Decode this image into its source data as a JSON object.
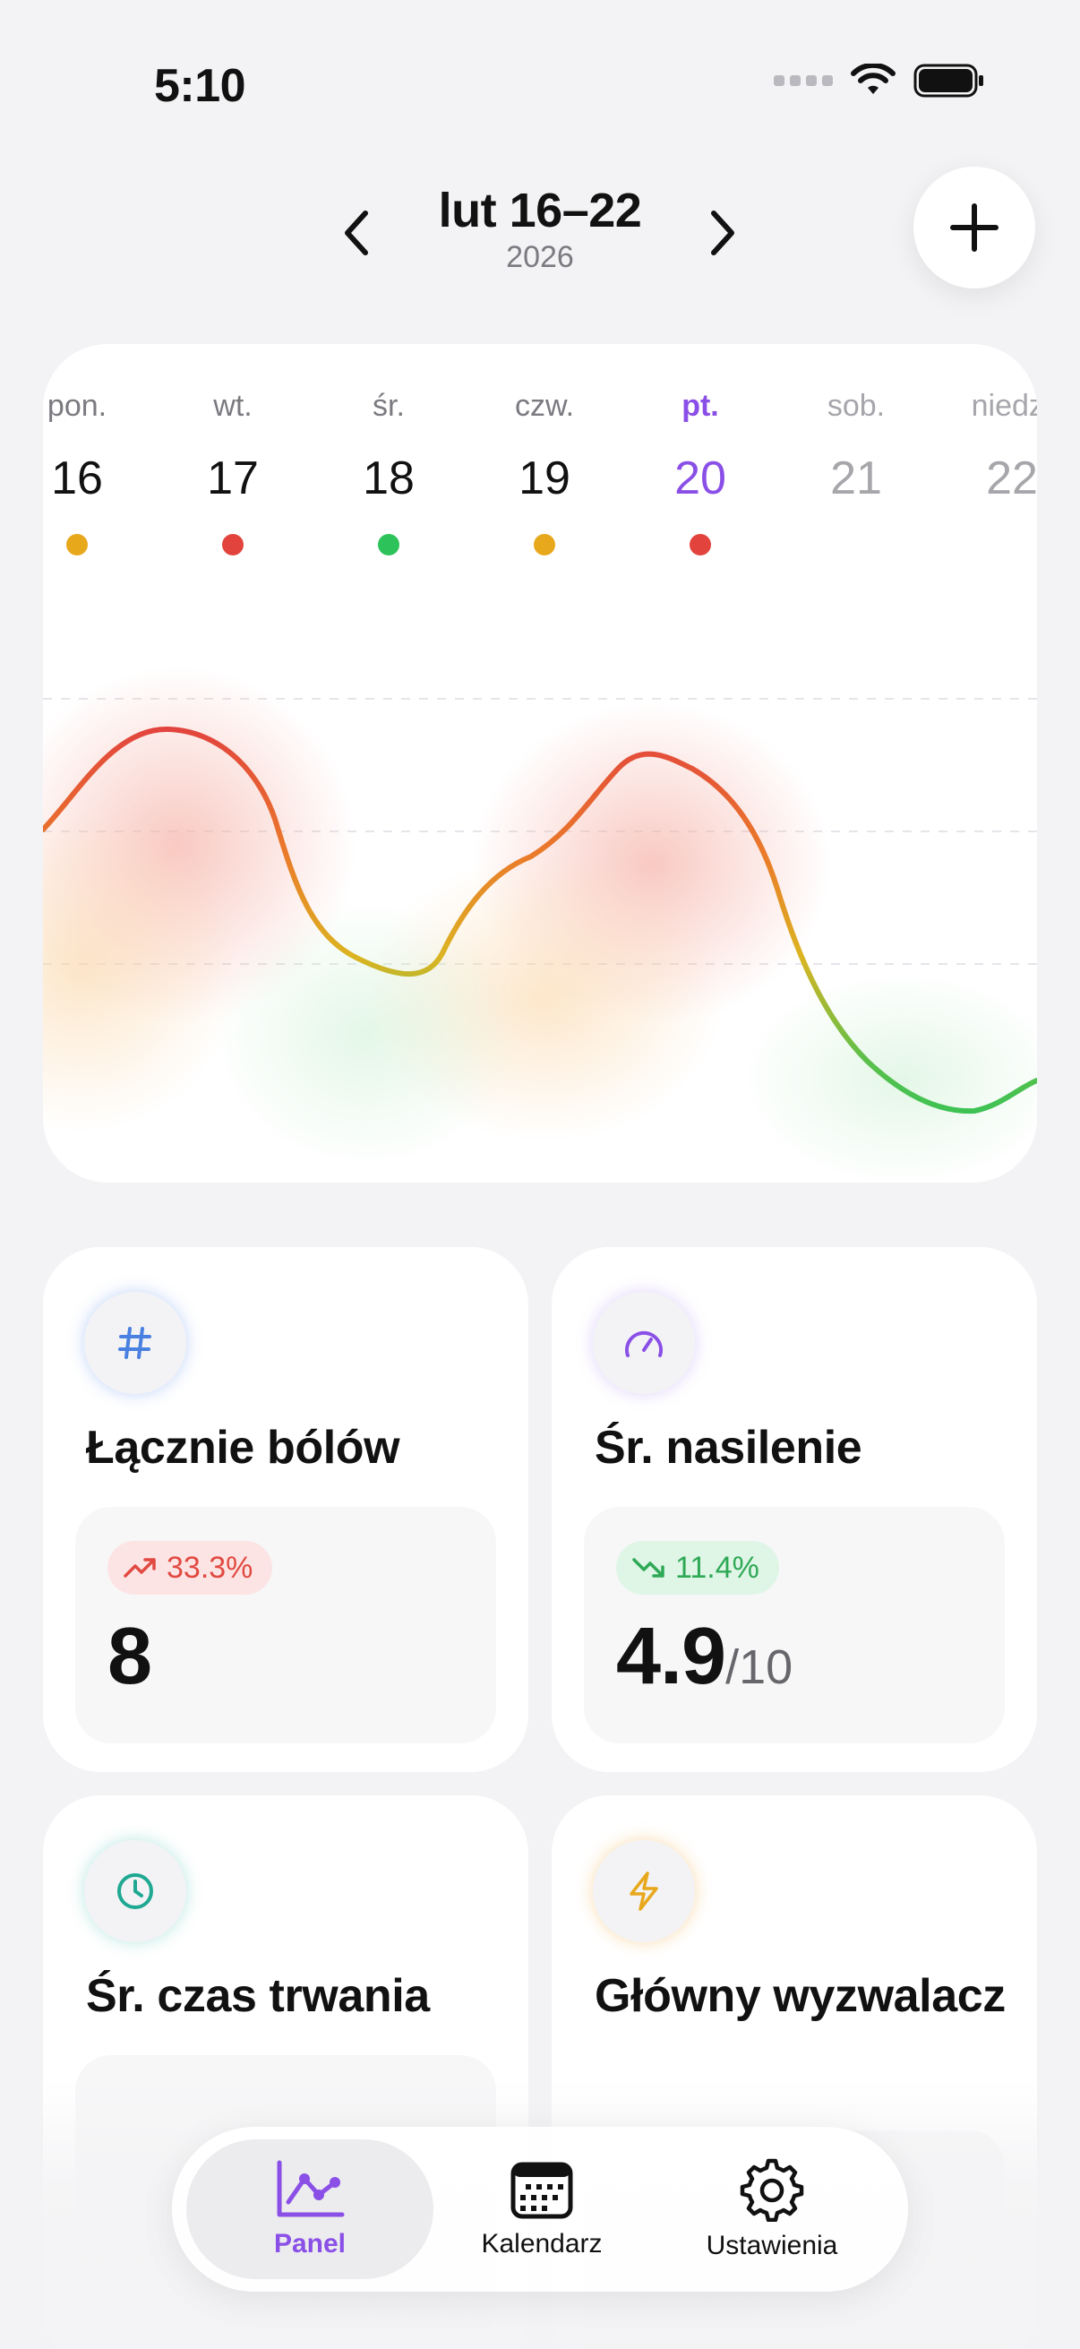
{
  "status": {
    "time": "5:10"
  },
  "week": {
    "title": "lut 16–22",
    "year": "2026",
    "days": [
      {
        "name": "pon.",
        "num": "16",
        "dot": "#e8a81c",
        "state": "past"
      },
      {
        "name": "wt.",
        "num": "17",
        "dot": "#e2443d",
        "state": "past"
      },
      {
        "name": "śr.",
        "num": "18",
        "dot": "#2ec35a",
        "state": "past"
      },
      {
        "name": "czw.",
        "num": "19",
        "dot": "#e8a81c",
        "state": "past"
      },
      {
        "name": "pt.",
        "num": "20",
        "dot": "#e2443d",
        "state": "active"
      },
      {
        "name": "sob.",
        "num": "21",
        "dot": null,
        "state": "future"
      },
      {
        "name": "niedz.",
        "num": "22",
        "dot": null,
        "state": "future"
      }
    ]
  },
  "colors": {
    "accent": "#8a4fe6",
    "high": "#e2443d",
    "medium": "#e8a81c",
    "low": "#2ec35a"
  },
  "stats": {
    "total": {
      "title": "Łącznie bólów",
      "change": "33.3%",
      "trend": "up",
      "value": "8",
      "icon": "hash-icon"
    },
    "severity": {
      "title": "Śr. nasilenie",
      "change": "11.4%",
      "trend": "down",
      "value": "4.9",
      "suffix": "/10",
      "icon": "gauge-icon"
    },
    "duration": {
      "title": "Śr. czas trwania",
      "icon": "clock-icon"
    },
    "trigger": {
      "title": "Główny wyzwalacz",
      "icon": "bolt-icon"
    }
  },
  "tabs": [
    {
      "label": "Panel",
      "icon": "chart-icon",
      "active": true
    },
    {
      "label": "Kalendarz",
      "icon": "calendar-icon",
      "active": false
    },
    {
      "label": "Ustawienia",
      "icon": "gear-icon",
      "active": false
    }
  ]
}
